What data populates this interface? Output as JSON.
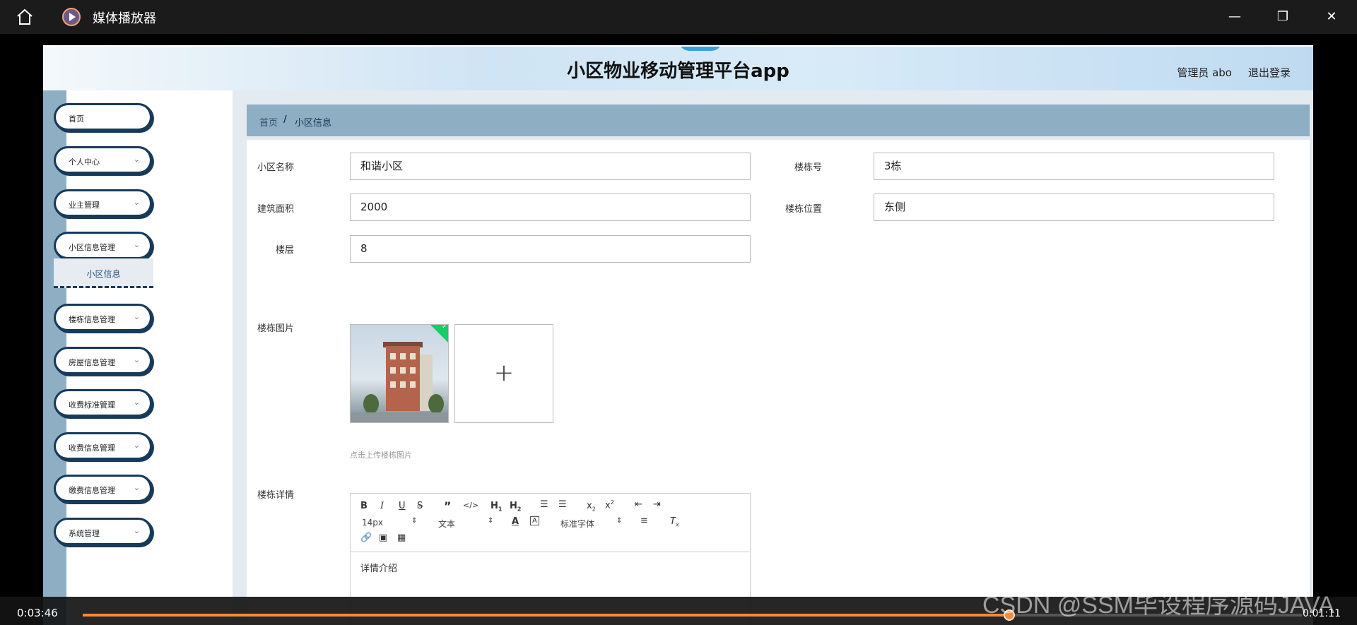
{
  "player": {
    "app_title": "媒体播放器",
    "time_elapsed": "0:03:46",
    "time_remaining": "0:01:11",
    "progress": 0.76,
    "accent_color": "#f28b3c"
  },
  "watermark": "CSDN @SSM毕设程序源码JAVA",
  "header": {
    "title": "小区物业移动管理平台app",
    "admin_label": "管理员 abo",
    "logout_label": "退出登录"
  },
  "sidebar": {
    "items": [
      {
        "label": "首页"
      },
      {
        "label": "个人中心"
      },
      {
        "label": "业主管理"
      },
      {
        "label": "小区信息管理"
      },
      {
        "label": "楼栋信息管理"
      },
      {
        "label": "房屋信息管理"
      },
      {
        "label": "收费标准管理"
      },
      {
        "label": "收费信息管理"
      },
      {
        "label": "缴费信息管理"
      },
      {
        "label": "系统管理"
      }
    ],
    "sub_item": "小区信息"
  },
  "breadcrumb": {
    "home": "首页",
    "separator": "/",
    "current": "小区信息"
  },
  "form": {
    "community_name": {
      "label": "小区名称",
      "value": "和谐小区"
    },
    "building_no": {
      "label": "楼栋号",
      "value": "3栋"
    },
    "area": {
      "label": "建筑面积",
      "value": "2000"
    },
    "building_location": {
      "label": "楼栋位置",
      "value": "东侧"
    },
    "floors": {
      "label": "楼层",
      "value": "8"
    },
    "building_image": {
      "label": "楼栋图片",
      "upload_hint": "点击上传楼栋图片",
      "uploader_symbol": "+"
    },
    "building_detail": {
      "label": "楼栋详情",
      "font_size": "14px",
      "format": "文本",
      "font_family": "标准字体",
      "content": "详情介绍"
    }
  }
}
